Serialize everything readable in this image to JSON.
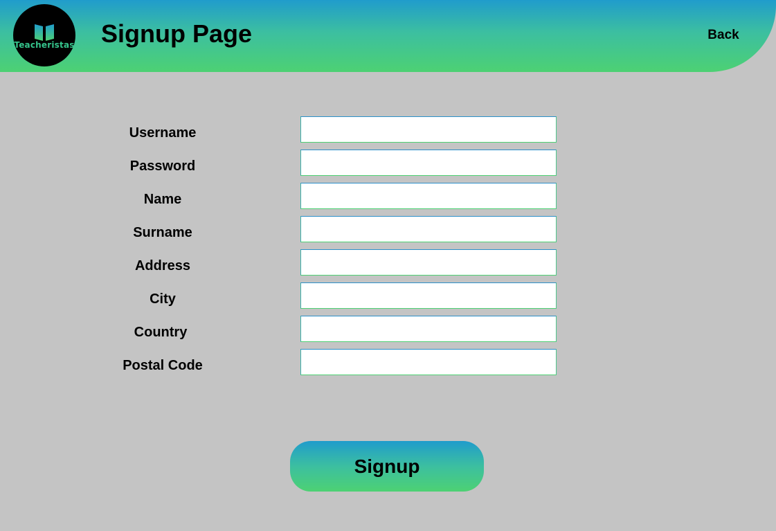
{
  "header": {
    "logo_text": "Teacheristas",
    "logo_icon": "open-book-icon",
    "title": "Signup Page",
    "back_label": "Back",
    "gradient": [
      "#209ccc",
      "#4dd173"
    ]
  },
  "form": {
    "fields": [
      {
        "label": "Username",
        "value": ""
      },
      {
        "label": "Password",
        "value": ""
      },
      {
        "label": "Name",
        "value": ""
      },
      {
        "label": "Surname",
        "value": ""
      },
      {
        "label": "Address",
        "value": ""
      },
      {
        "label": "City",
        "value": ""
      },
      {
        "label": "Country",
        "value": ""
      },
      {
        "label": "Postal Code",
        "value": ""
      }
    ],
    "submit_label": "Signup"
  },
  "colors": {
    "background": "#c4c4c4",
    "accent_top": "#209ccc",
    "accent_bottom": "#4dd173"
  }
}
